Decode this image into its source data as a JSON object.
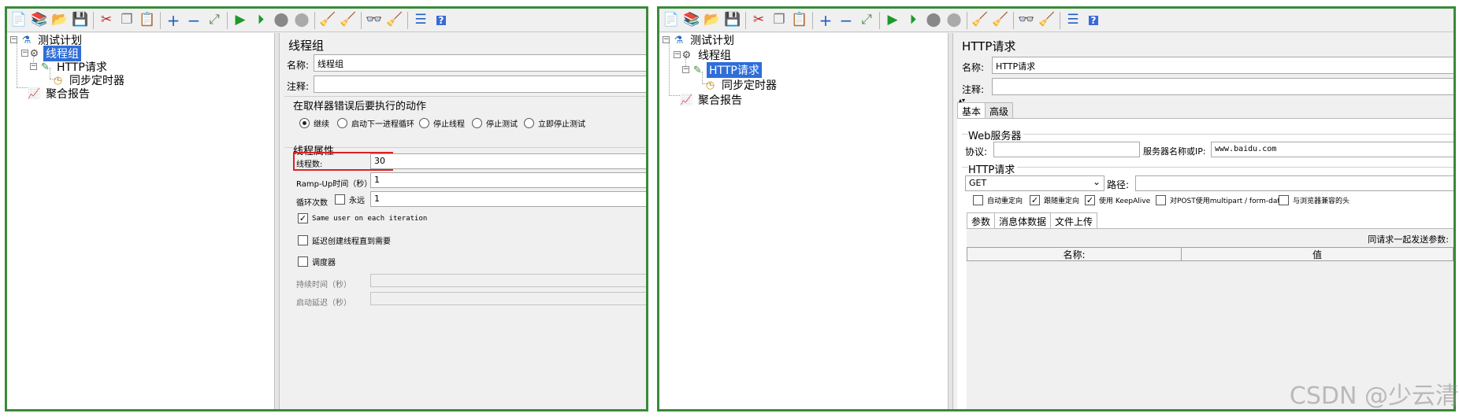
{
  "toolbar_icons": [
    "new-icon",
    "templates-icon",
    "open-icon",
    "save-icon",
    "cut-icon",
    "copy-icon",
    "paste-icon",
    "expand-icon",
    "collapse-icon",
    "toggle-icon",
    "start-icon",
    "start-no-pause-icon",
    "stop-icon",
    "shutdown-icon",
    "clear-icon",
    "clear-all-icon",
    "search-icon",
    "reset-search-icon",
    "function-helper-icon",
    "help-icon"
  ],
  "left": {
    "tree": {
      "test_plan": "测试计划",
      "thread_group": "线程组",
      "http_request": "HTTP请求",
      "sync_timer": "同步定时器",
      "aggregate_report": "聚合报告"
    },
    "form": {
      "title": "线程组",
      "name_label": "名称:",
      "name_value": "线程组",
      "comment_label": "注释:",
      "comment_value": "",
      "error_section": "在取样器错误后要执行的动作",
      "error_options": [
        "继续",
        "启动下一进程循环",
        "停止线程",
        "停止测试",
        "立即停止测试"
      ],
      "thread_props": "线程属性",
      "threads_label": "线程数:",
      "threads_value": "30",
      "rampup_label": "Ramp-Up时间（秒）:",
      "rampup_value": "1",
      "loop_label": "循环次数",
      "forever_label": "永远",
      "loop_value": "1",
      "same_user": "Same user on each iteration",
      "delay_create": "延迟创建线程直到需要",
      "scheduler": "调度器",
      "duration_label": "持续时间（秒）",
      "startup_delay_label": "启动延迟（秒）"
    }
  },
  "right": {
    "tree": {
      "test_plan": "测试计划",
      "thread_group": "线程组",
      "http_request": "HTTP请求",
      "sync_timer": "同步定时器",
      "aggregate_report": "聚合报告"
    },
    "form": {
      "title": "HTTP请求",
      "name_label": "名称:",
      "name_value": "HTTP请求",
      "comment_label": "注释:",
      "comment_value": "",
      "tab_basic": "基本",
      "tab_advanced": "高级",
      "web_server": "Web服务器",
      "protocol_label": "协议:",
      "protocol_value": "",
      "server_label": "服务器名称或IP:",
      "server_value": "www.baidu.com",
      "http_request_section": "HTTP请求",
      "method": "GET",
      "path_label": "路径:",
      "path_value": "",
      "checkboxes": [
        "自动重定向",
        "跟随重定向",
        "使用 KeepAlive",
        "对POST使用multipart / form-data",
        "与浏览器兼容的头"
      ],
      "sub_tabs": [
        "参数",
        "消息体数据",
        "文件上传"
      ],
      "send_with_request": "同请求一起发送参数:",
      "col_name": "名称:",
      "col_value": "值"
    }
  },
  "watermark": "CSDN @少云清"
}
